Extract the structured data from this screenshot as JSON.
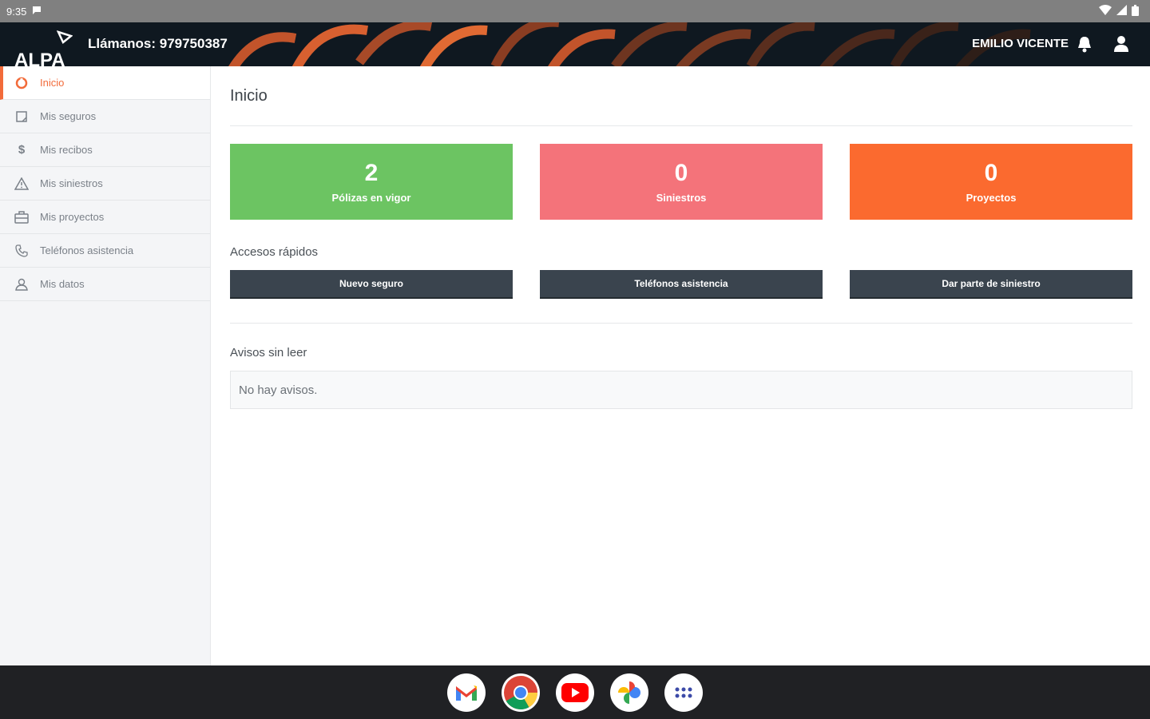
{
  "statusbar": {
    "time": "9:35"
  },
  "header": {
    "logo": "ALPA",
    "phone": "Llámanos: 979750387",
    "user": "EMILIO VICENTE"
  },
  "sidebar": {
    "items": [
      {
        "label": "Inicio",
        "icon": "home-icon",
        "active": true
      },
      {
        "label": "Mis seguros",
        "icon": "policy-icon",
        "active": false
      },
      {
        "label": "Mis recibos",
        "icon": "dollar-icon",
        "active": false
      },
      {
        "label": "Mis siniestros",
        "icon": "warning-icon",
        "active": false
      },
      {
        "label": "Mis proyectos",
        "icon": "briefcase-icon",
        "active": false
      },
      {
        "label": "Teléfonos asistencia",
        "icon": "phone-icon",
        "active": false
      },
      {
        "label": "Mis datos",
        "icon": "user-icon",
        "active": false
      }
    ]
  },
  "main": {
    "title": "Inicio",
    "stats": [
      {
        "value": "2",
        "label": "Pólizas en vigor",
        "color": "#6cc462"
      },
      {
        "value": "0",
        "label": "Siniestros",
        "color": "#f4737a"
      },
      {
        "value": "0",
        "label": "Proyectos",
        "color": "#fb6a2f"
      }
    ],
    "quick_title": "Accesos rápidos",
    "quick": [
      {
        "label": "Nuevo seguro"
      },
      {
        "label": "Teléfonos asistencia"
      },
      {
        "label": "Dar parte de siniestro"
      }
    ],
    "notices_title": "Avisos sin leer",
    "notices_empty": "No hay avisos."
  },
  "taskbar": {
    "apps": [
      "gmail-icon",
      "chrome-icon",
      "youtube-icon",
      "photos-icon",
      "apps-grid-icon"
    ]
  },
  "colors": {
    "accent": "#f26b3a",
    "header_bg": "#0f1820",
    "button_bg": "#3a444e"
  }
}
